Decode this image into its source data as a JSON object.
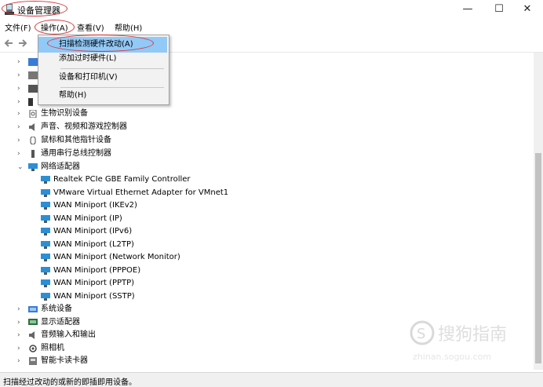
{
  "window": {
    "title": "设备管理器",
    "controls": {
      "minimize": "—",
      "maximize": "☐",
      "close": "✕"
    }
  },
  "menubar": [
    "文件(F)",
    "操作(A)",
    "查看(V)",
    "帮助(H)"
  ],
  "dropdown": {
    "items": [
      "扫描检测硬件改动(A)",
      "添加过时硬件(L)",
      "设备和打印机(V)",
      "帮助(H)"
    ],
    "highlighted_index": 0
  },
  "tree": {
    "categories_top": [
      "生物识别设备",
      "声音、视频和游戏控制器",
      "鼠标和其他指针设备",
      "通用串行总线控制器",
      "网络适配器"
    ],
    "network_adapters": [
      "Realtek PCIe GBE Family Controller",
      "VMware Virtual Ethernet Adapter for VMnet1",
      "WAN Miniport (IKEv2)",
      "WAN Miniport (IP)",
      "WAN Miniport (IPv6)",
      "WAN Miniport (L2TP)",
      "WAN Miniport (Network Monitor)",
      "WAN Miniport (PPPOE)",
      "WAN Miniport (PPTP)",
      "WAN Miniport (SSTP)"
    ],
    "categories_bottom": [
      "系统设备",
      "显示适配器",
      "音频输入和输出",
      "照相机",
      "智能卡读卡器"
    ]
  },
  "statusbar": {
    "text": "扫描经过改动的或新的即插即用设备。"
  },
  "watermark": {
    "text": "搜狗指南",
    "url": "zhinan.sogou.com"
  },
  "colors": {
    "highlight": "#91c9f7",
    "annotation": "#d9343a",
    "adapter_icon": "#2b8fd6"
  }
}
